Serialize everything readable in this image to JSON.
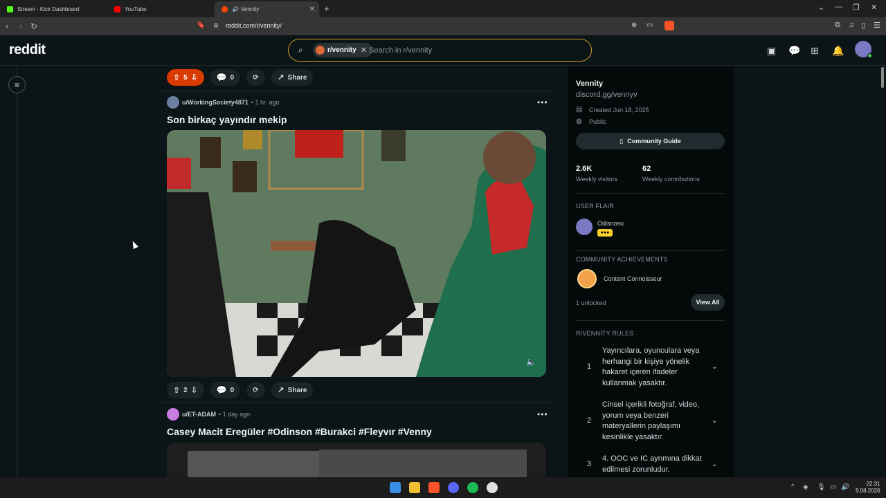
{
  "browser": {
    "tabs": [
      {
        "title": "Stream - Kick Dashboard",
        "color": "#53fc18",
        "active": false
      },
      {
        "title": "YouTube",
        "color": "#ff0000",
        "active": false
      },
      {
        "title": "Vennity",
        "color": "#ff4500",
        "active": true
      }
    ],
    "url": "reddit.com/r/vennity/"
  },
  "reddit": {
    "logo": "reddit",
    "search_chip": "r/vennity",
    "search_placeholder": "Search in r/vennity"
  },
  "post_prev": {
    "votes": "5",
    "comments": "0",
    "share": "Share"
  },
  "post1": {
    "user": "u/WorkingSociety4871",
    "time": "• 1 hr. ago",
    "title": "Son birkaç yayındır mekip",
    "votes": "2",
    "comments": "0",
    "share": "Share"
  },
  "post2": {
    "user": "u/ET-ADAM",
    "time": "• 1 day ago",
    "title": "Casey Macit Eregüler #Odinson #Burakci #Fleyvır #Venny"
  },
  "sidebar": {
    "name": "Vennity",
    "link": "discord.gg/vennyv",
    "created": "Created Jun 18, 2025",
    "visibility": "Public",
    "guide": "Community Guide",
    "visitors_num": "2.6K",
    "visitors_lbl": "Weekly visitors",
    "contrib_num": "62",
    "contrib_lbl": "Weekly contributions",
    "flair_head": "USER FLAIR",
    "flair_name": "Odisnosu",
    "ach_head": "COMMUNITY ACHIEVEMENTS",
    "ach_name": "Content Connoisseur",
    "ach_unlocked": "1 unlocked",
    "view_all": "View All",
    "rules_head": "R/VENNITY RULES",
    "rules": [
      {
        "num": "1",
        "text": "Yayıncılara, oyunculara veya herhangi bir kişiye yönelik hakaret içeren ifadeler kullanmak yasaktır."
      },
      {
        "num": "2",
        "text": "Cinsel içerikli fotoğraf, video, yorum veya benzeri materyallerin paylaşımı kesinlikle yasaktır."
      },
      {
        "num": "3",
        "text": "4. OOC ve IC ayrımına dikkat edilmesi zorunludur."
      }
    ]
  },
  "taskbar": {
    "time": "22:31",
    "date": "9.08.2026"
  }
}
